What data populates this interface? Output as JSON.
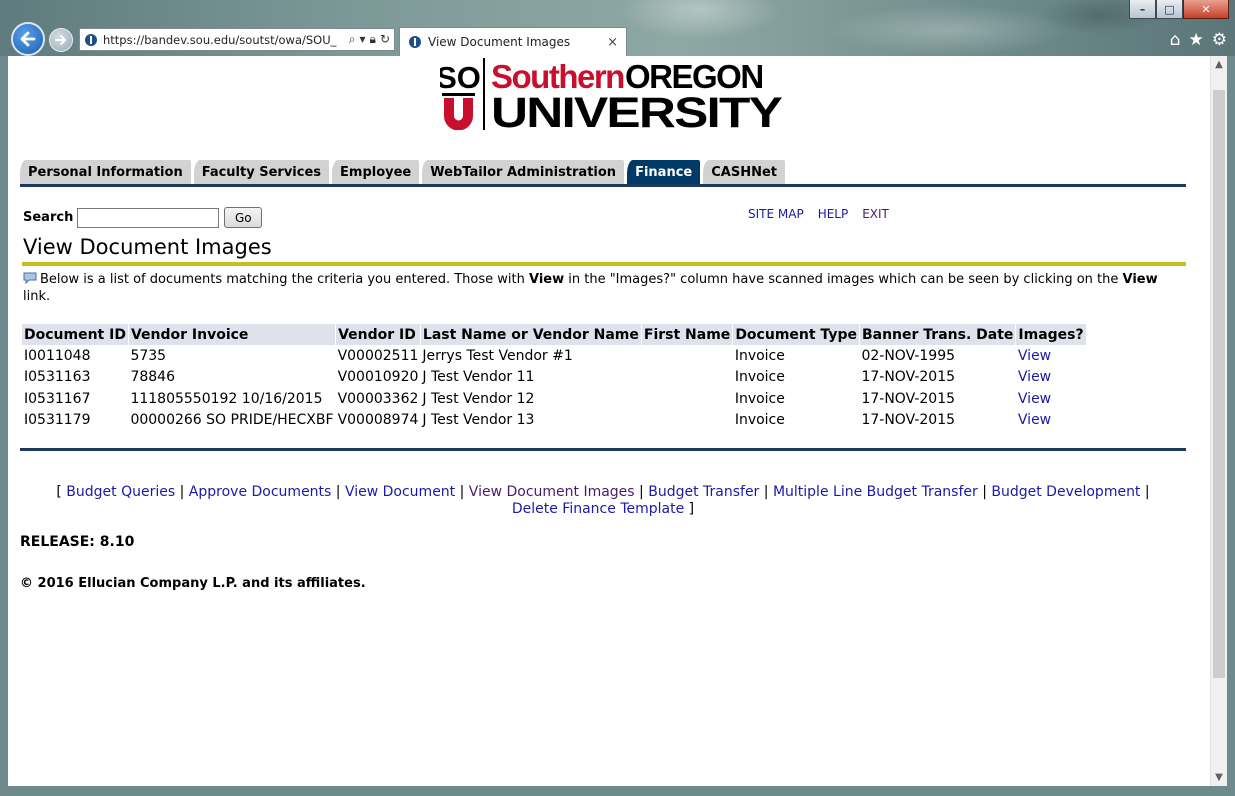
{
  "browser": {
    "url": "https://bandev.sou.edu/soutst/owa/SOU_",
    "tab_title": "View Document Images",
    "tab_close": "×",
    "window_buttons": {
      "minimize": "–",
      "maximize": "□",
      "close": "✕"
    }
  },
  "logo": {
    "sou_top": "SO",
    "sou_bottom": "U",
    "line1_a": "Southern",
    "line1_b": "OREGON",
    "line2": "UNIVERSITY"
  },
  "nav_tabs": [
    {
      "label": "Personal Information",
      "active": false
    },
    {
      "label": "Faculty Services",
      "active": false
    },
    {
      "label": "Employee",
      "active": false
    },
    {
      "label": "WebTailor Administration",
      "active": false
    },
    {
      "label": "Finance",
      "active": true
    },
    {
      "label": "CASHNet",
      "active": false
    }
  ],
  "search": {
    "label": "Search",
    "value": "",
    "button": "Go"
  },
  "toplinks": {
    "site_map": "SITE MAP",
    "help": "HELP",
    "exit": "EXIT"
  },
  "page_title": "View Document Images",
  "info": {
    "part1": "Below is a list of documents matching the criteria you entered. Those with ",
    "bold1": "View",
    "part2": " in the \"Images?\" column have scanned images which can be seen by clicking on the ",
    "bold2": "View",
    "part3": " link."
  },
  "table": {
    "headers": [
      "Document ID",
      "Vendor Invoice",
      "Vendor ID",
      "Last Name or Vendor Name",
      "First Name",
      "Document Type",
      "Banner Trans. Date",
      "Images?"
    ],
    "rows": [
      [
        "I0011048",
        "5735",
        "V00002511",
        "Jerrys Test Vendor #1",
        "",
        "Invoice",
        "02-NOV-1995",
        "View"
      ],
      [
        "I0531163",
        "78846",
        "V00010920",
        "J Test Vendor 11",
        "",
        "Invoice",
        "17-NOV-2015",
        "View"
      ],
      [
        "I0531167",
        "111805550192 10/16/2015",
        "V00003362",
        "J Test Vendor 12",
        "",
        "Invoice",
        "17-NOV-2015",
        "View"
      ],
      [
        "I0531179",
        "00000266 SO PRIDE/HECXBF",
        "V00008974",
        "J Test Vendor 13",
        "",
        "Invoice",
        "17-NOV-2015",
        "View"
      ]
    ]
  },
  "bottom_links": {
    "open_bracket": "[",
    "close_bracket": "]",
    "sep": "|",
    "items": [
      "Budget Queries",
      "Approve Documents",
      "View Document",
      "View Document Images",
      "Budget Transfer",
      "Multiple Line Budget Transfer",
      "Budget Development",
      "Delete Finance Template"
    ]
  },
  "release": "RELEASE: 8.10",
  "copyright": "© 2016 Ellucian Company L.P. and its affiliates.",
  "colors": {
    "tab_active": "#013a67",
    "tab_inactive": "#d2d2d2",
    "rule_navy": "#1b3a5c",
    "rule_gold": "#c9be1e",
    "link": "#1a1aa6",
    "visited": "#4b1a6e",
    "sou_red": "#c8102e"
  }
}
